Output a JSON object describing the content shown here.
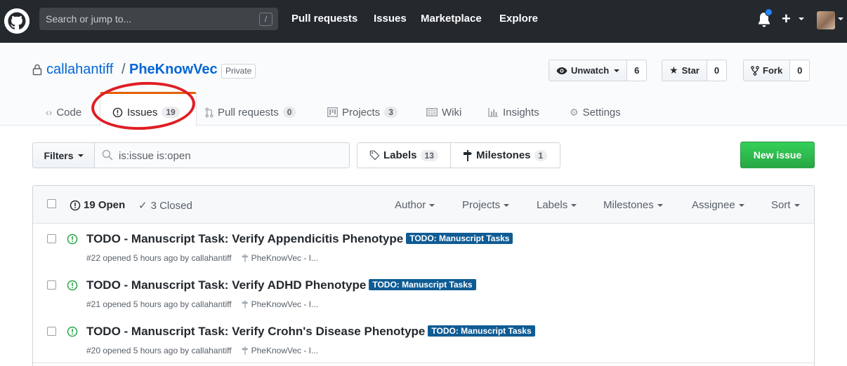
{
  "header": {
    "search_placeholder": "Search or jump to...",
    "search_shortcut": "/",
    "nav": [
      "Pull requests",
      "Issues",
      "Marketplace",
      "Explore"
    ],
    "plus_label": "+"
  },
  "repo": {
    "owner": "callahantiff",
    "separator": "/",
    "name": "PheKnowVec",
    "visibility": "Private",
    "watch_label": "Unwatch",
    "watch_count": "6",
    "star_label": "Star",
    "star_count": "0",
    "fork_label": "Fork",
    "fork_count": "0"
  },
  "tabs": [
    {
      "label": "Code",
      "icon": "code-icon"
    },
    {
      "label": "Issues",
      "count": "19",
      "icon": "issue-icon",
      "selected": true
    },
    {
      "label": "Pull requests",
      "count": "0",
      "icon": "pull-request-icon"
    },
    {
      "label": "Projects",
      "count": "3",
      "icon": "project-icon"
    },
    {
      "label": "Wiki",
      "icon": "book-icon"
    },
    {
      "label": "Insights",
      "icon": "graph-icon"
    },
    {
      "label": "Settings",
      "icon": "gear-icon"
    }
  ],
  "filters": {
    "button_label": "Filters",
    "query": "is:issue is:open",
    "labels_label": "Labels",
    "labels_count": "13",
    "milestones_label": "Milestones",
    "milestones_count": "1",
    "new_issue_label": "New issue"
  },
  "issue_list": {
    "open_label": "19 Open",
    "closed_label": "3 Closed",
    "sort_menus": [
      "Author",
      "Projects",
      "Labels",
      "Milestones",
      "Assignee",
      "Sort"
    ],
    "issues": [
      {
        "title": "TODO - Manuscript Task: Verify Appendicitis Phenotype",
        "label": "TODO: Manuscript Tasks",
        "meta": "#22 opened 5 hours ago by callahantiff",
        "milestone": "PheKnowVec - I..."
      },
      {
        "title": "TODO - Manuscript Task: Verify ADHD Phenotype",
        "label": "TODO: Manuscript Tasks",
        "meta": "#21 opened 5 hours ago by callahantiff",
        "milestone": "PheKnowVec - I..."
      },
      {
        "title": "TODO - Manuscript Task: Verify Crohn's Disease Phenotype",
        "label": "TODO: Manuscript Tasks",
        "meta": "#20 opened 5 hours ago by callahantiff",
        "milestone": "PheKnowVec - I..."
      }
    ]
  },
  "colors": {
    "header_bg": "#24292e",
    "link_blue": "#0366d6",
    "open_green": "#28a745",
    "label_blue": "#0f5c94",
    "annotation_red": "#e01e24",
    "selected_tab_border": "#e36209"
  }
}
